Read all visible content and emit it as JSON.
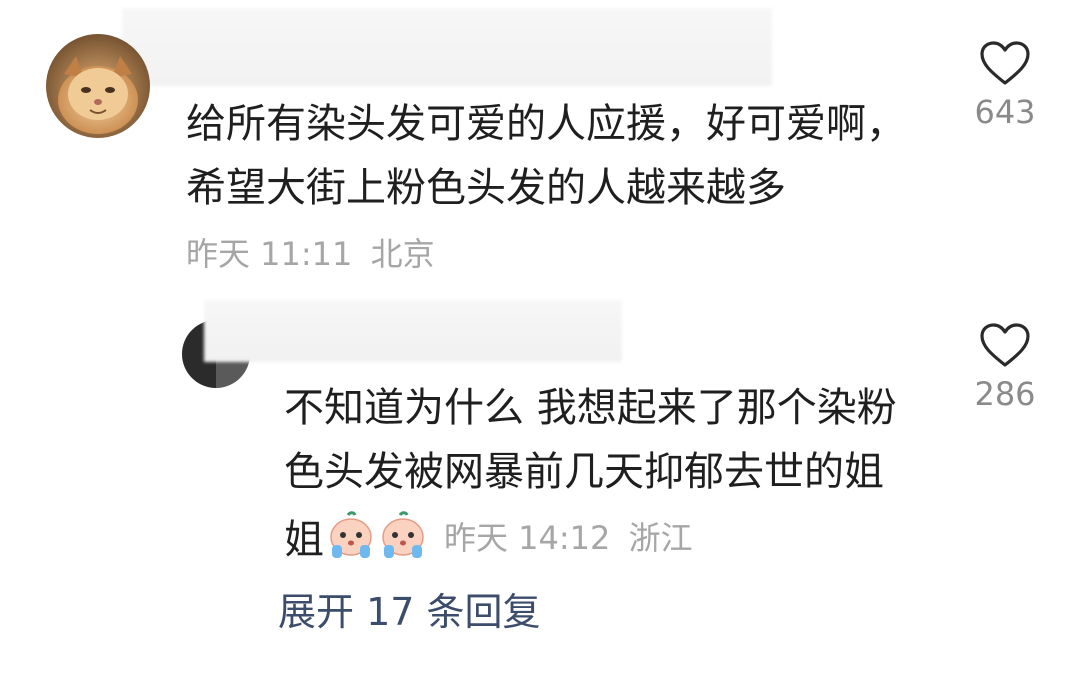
{
  "comment": {
    "text": "给所有染头发可爱的人应援，好可爱啊，希望大街上粉色头发的人越来越多",
    "time": "昨天 11:11",
    "location": "北京",
    "likes": "643"
  },
  "reply": {
    "text_main": "不知道为什么 我想起来了那个染粉色头发被网暴前几天抑郁去世的姐",
    "text_tail": "姐",
    "emojis": [
      "crying-emoji",
      "crying-emoji"
    ],
    "time": "昨天 14:12",
    "location": "浙江",
    "likes": "286"
  },
  "expand_label": "展开 17 条回复",
  "colors": {
    "text": "#1f1f1f",
    "meta": "#a6a6a6",
    "link": "#3b4d6b"
  }
}
